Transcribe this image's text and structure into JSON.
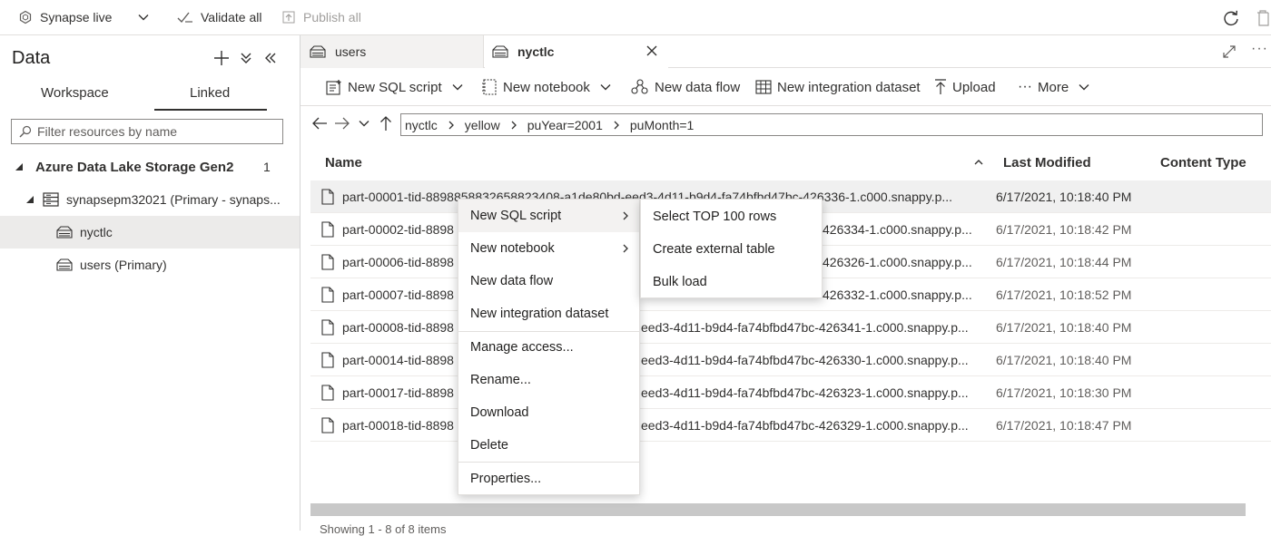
{
  "topbar": {
    "workspace": "Synapse live",
    "validate": "Validate all",
    "publish": "Publish all"
  },
  "left": {
    "title": "Data",
    "tabs": [
      "Workspace",
      "Linked"
    ],
    "active_tab": "Linked",
    "filter_placeholder": "Filter resources by name",
    "group": {
      "label": "Azure Data Lake Storage Gen2",
      "count": "1"
    },
    "account": "synapsepm32021 (Primary - synaps...",
    "containers": [
      "nyctlc",
      "users (Primary)"
    ],
    "selected_container": "nyctlc"
  },
  "tabs": [
    {
      "label": "users",
      "active": false
    },
    {
      "label": "nyctlc",
      "active": true
    }
  ],
  "commands": {
    "new_sql": "New SQL script",
    "new_notebook": "New notebook",
    "new_dataflow": "New data flow",
    "new_dataset": "New integration dataset",
    "upload": "Upload",
    "more": "More"
  },
  "path": [
    "nyctlc",
    "yellow",
    "puYear=2001",
    "puMonth=1"
  ],
  "grid": {
    "columns": [
      "Name",
      "Last Modified",
      "Content Type"
    ],
    "rows": [
      {
        "name": "part-00001-tid-8898858832658823408-a1de80bd-eed3-4d11-b9d4-fa74bfbd47bc-426336-1.c000.snappy.p...",
        "modified": "6/17/2021, 10:18:40 PM"
      },
      {
        "name": "part-00002-tid-8898",
        "name_tail": "426334-1.c000.snappy.p...",
        "modified": "6/17/2021, 10:18:42 PM"
      },
      {
        "name": "part-00006-tid-8898",
        "name_tail": "426326-1.c000.snappy.p...",
        "modified": "6/17/2021, 10:18:44 PM"
      },
      {
        "name": "part-00007-tid-8898",
        "name_tail": "426332-1.c000.snappy.p...",
        "modified": "6/17/2021, 10:18:52 PM"
      },
      {
        "name": "part-00008-tid-8898",
        "name_tail": "eed3-4d11-b9d4-fa74bfbd47bc-426341-1.c000.snappy.p...",
        "modified": "6/17/2021, 10:18:40 PM"
      },
      {
        "name": "part-00014-tid-8898",
        "name_tail": "eed3-4d11-b9d4-fa74bfbd47bc-426330-1.c000.snappy.p...",
        "modified": "6/17/2021, 10:18:40 PM"
      },
      {
        "name": "part-00017-tid-8898",
        "name_tail": "eed3-4d11-b9d4-fa74bfbd47bc-426323-1.c000.snappy.p...",
        "modified": "6/17/2021, 10:18:30 PM"
      },
      {
        "name": "part-00018-tid-8898",
        "name_tail": "eed3-4d11-b9d4-fa74bfbd47bc-426329-1.c000.snappy.p...",
        "modified": "6/17/2021, 10:18:47 PM"
      }
    ]
  },
  "context_menu": {
    "items": [
      "New SQL script",
      "New notebook",
      "New data flow",
      "New integration dataset",
      "Manage access...",
      "Rename...",
      "Download",
      "Delete",
      "Properties..."
    ]
  },
  "submenu": {
    "items": [
      "Select TOP 100 rows",
      "Create external table",
      "Bulk load"
    ]
  },
  "status": "Showing 1 - 8 of 8 items",
  "icons": {
    "workspace": "synapse-hex-icon",
    "validate": "checkmark-icon",
    "publish": "upload-icon",
    "refresh": "refresh-icon",
    "discard": "trash-icon",
    "file": "file-icon",
    "container": "container-icon",
    "storage": "storage-account-icon"
  }
}
